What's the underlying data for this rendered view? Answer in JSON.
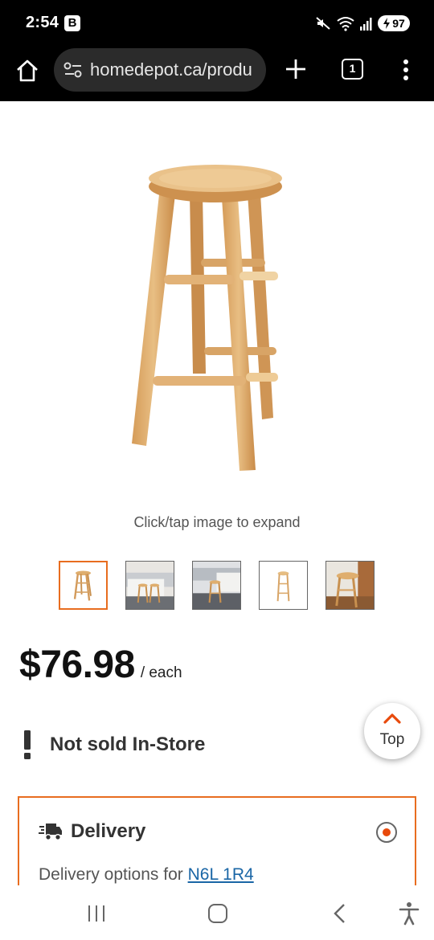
{
  "status_bar": {
    "time": "2:54",
    "badge": "B",
    "battery": "97"
  },
  "browser": {
    "url": "homedepot.ca/produ",
    "tab_count": "1"
  },
  "product": {
    "expand_hint": "Click/tap image to expand",
    "thumbnail_count": 5,
    "selected_thumbnail": 1,
    "price": "$76.98",
    "price_unit": "/ each",
    "availability": "Not sold In-Store"
  },
  "back_to_top": {
    "label": "Top"
  },
  "delivery": {
    "title": "Delivery",
    "options_prefix": "Delivery options for",
    "postal_code": "N6L 1R4",
    "selected": true
  },
  "colors": {
    "accent": "#e86d1f",
    "link": "#1a66a6",
    "radio": "#e84a0c",
    "chrome": "#000000"
  },
  "icons": [
    "home-icon",
    "tune-icon",
    "plus-icon",
    "tabs-icon",
    "more-vert-icon",
    "exclamation-icon",
    "chevron-up-icon",
    "truck-icon",
    "radio-icon",
    "recents-icon",
    "home-nav-icon",
    "back-icon",
    "accessibility-icon"
  ]
}
